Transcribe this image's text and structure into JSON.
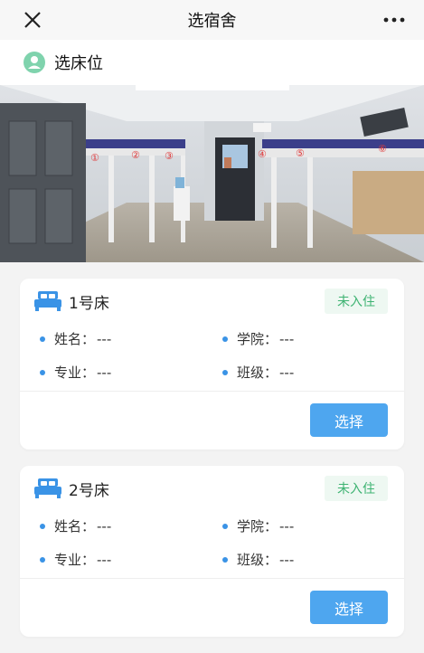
{
  "navbar": {
    "title": "选宿舍",
    "close_icon": "close-icon",
    "more_icon": "more-icon"
  },
  "subhead": {
    "label": "选床位",
    "icon": "user-icon",
    "icon_color": "#7fd3ad"
  },
  "photo": {
    "bed_numbers": [
      "①",
      "②",
      "③",
      "④",
      "⑤",
      "⑥"
    ]
  },
  "beds": [
    {
      "title": "1号床",
      "status": "未入住",
      "name_label": "姓名：",
      "name_value": "---",
      "college_label": "学院：",
      "college_value": "---",
      "major_label": "专业：",
      "major_value": "---",
      "class_label": "班级：",
      "class_value": "---",
      "button": "选择"
    },
    {
      "title": "2号床",
      "status": "未入住",
      "name_label": "姓名：",
      "name_value": "---",
      "college_label": "学院：",
      "college_value": "---",
      "major_label": "专业：",
      "major_value": "---",
      "class_label": "班级：",
      "class_value": "---",
      "button": "选择"
    }
  ],
  "colors": {
    "accent": "#4ea6ef",
    "status_green": "#3eb372",
    "dot_blue": "#3a93e6"
  }
}
